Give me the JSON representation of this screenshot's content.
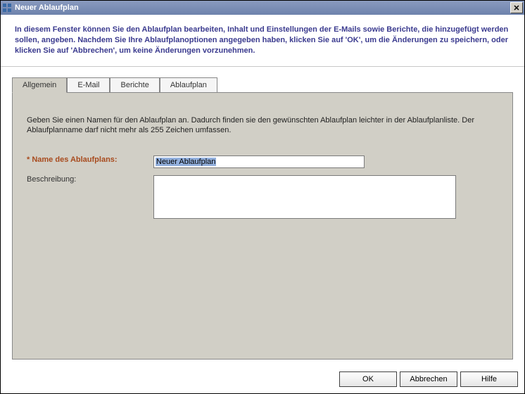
{
  "window": {
    "title": "Neuer Ablaufplan"
  },
  "instructions": "In diesem Fenster können Sie den Ablaufplan bearbeiten, Inhalt und Einstellungen der E-Mails sowie Berichte, die hinzugefügt werden sollen, angeben. Nachdem Sie Ihre Ablaufplanoptionen angegeben haben, klicken Sie auf 'OK', um die Änderungen zu speichern, oder klicken Sie auf 'Abbrechen', um keine Änderungen vorzunehmen.",
  "tabs": {
    "items": [
      {
        "label": "Allgemein",
        "active": true
      },
      {
        "label": "E-Mail",
        "active": false
      },
      {
        "label": "Berichte",
        "active": false
      },
      {
        "label": "Ablaufplan",
        "active": false
      }
    ]
  },
  "panel": {
    "description": "Geben Sie einen Namen für den Ablaufplan an. Dadurch finden sie den gewünschten Ablaufplan leichter in der Ablaufplanliste. Der Ablaufplanname darf nicht mehr als 255 Zeichen umfassen.",
    "name_label": "* Name des Ablaufplans:",
    "name_value": "Neuer Ablaufplan",
    "desc_label": "Beschreibung:",
    "desc_value": ""
  },
  "buttons": {
    "ok": "OK",
    "cancel": "Abbrechen",
    "help": "Hilfe"
  }
}
